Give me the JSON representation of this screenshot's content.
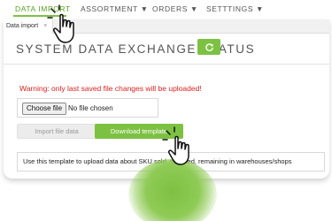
{
  "nav": {
    "items": [
      {
        "label": "DATA IMPORT",
        "active": true
      },
      {
        "label": "ASSORTMENT ▼",
        "active": false
      },
      {
        "label": "ORDERS ▼",
        "active": false
      },
      {
        "label": "SETTTINGS ▼",
        "active": false
      }
    ]
  },
  "tabs": [
    {
      "label": "Data import",
      "close": "×"
    }
  ],
  "page": {
    "title": "SYSTEM DATA EXCHANGE STATUS",
    "refresh_icon": "refresh-icon"
  },
  "warning": "Warning: only last saved file changes will be uploaded!",
  "file_input": {
    "button_label": "Choose file",
    "status": "No file chosen"
  },
  "actions": {
    "import_label": "Import file data",
    "download_label": "Download template"
  },
  "info": "Use this template to upload data about SKU sold, supplied, remaining in warehouses/shops",
  "colors": {
    "accent": "#7dc142",
    "warning": "#e02020",
    "active_nav": "#5aa31f"
  }
}
